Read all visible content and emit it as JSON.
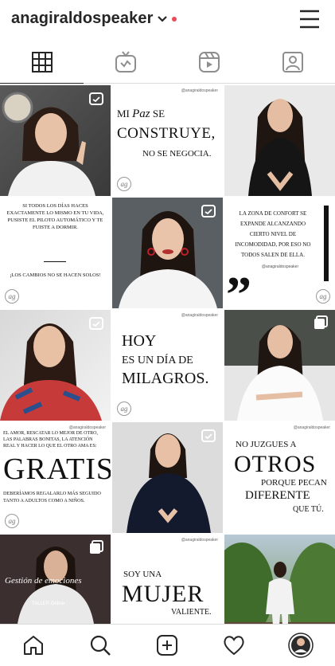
{
  "profile": {
    "username": "anagiraldospeaker"
  },
  "header": {
    "chevron_icon": "chevron-down-icon",
    "notification_color": "#ed4956",
    "menu_icon": "hamburger-menu-icon"
  },
  "tabs": [
    {
      "icon": "grid-icon",
      "active": true
    },
    {
      "icon": "igtv-icon",
      "active": false
    },
    {
      "icon": "reels-icon",
      "active": false
    },
    {
      "icon": "tagged-icon",
      "active": false
    }
  ],
  "posts": {
    "handle": "@anagiraldospeaker",
    "watermark": "ag",
    "p2": {
      "l1_a": "MI",
      "l1_script": "Paz",
      "l1_b": "SE",
      "l2": "CONSTRUYE,",
      "l3": "NO SE NEGOCIA."
    },
    "p4": {
      "l1": "SI TODOS LOS DÍAS HACES",
      "l2": "EXACTAMENTE LO MISMO EN TU VIDA,",
      "l3": "PUSISTE EL PILOTO AUTOMÁTICO Y TE",
      "l4": "FUISTE A DORMIR.",
      "l5": "¡LOS CAMBIOS NO SE HACEN SOLOS!"
    },
    "p6": {
      "l1": "LA ZONA DE CONFORT SE",
      "l2": "EXPANDE ALCANZANDO",
      "l3": "CIERTO NIVEL DE",
      "l4": "INCOMODIDAD, POR ESO NO",
      "l5": "TODOS SALEN DE ELLA.",
      "l6": "@anagiraldospeaker"
    },
    "p8": {
      "l1": "HOY",
      "l2": "ES UN DÍA DE",
      "l3": "MILAGROS."
    },
    "p10": {
      "l1": "EL AMOR, RESCATAR LO MEJOR DE OTRO,",
      "l2": "LAS PALABRAS BONITAS, LA ATENCIÓN",
      "l3": "REAL Y HACER LO QUE EL OTRO AMA ES:",
      "l4": "GRATIS",
      "l5": "DEBERÍAMOS REGALARLO MÁS SEGUIDO",
      "l6": "TANTO A ADULTOS COMO A NIÑOS."
    },
    "p12": {
      "l1": "NO JUZGUES A",
      "l2": "OTROS",
      "l3": "PORQUE PECAN",
      "l4": "DIFERENTE",
      "l5": "QUE TÚ."
    },
    "p13": {
      "l1": "Gestión de emociones",
      "l2": "TALLER Online"
    },
    "p14": {
      "l1": "SOY UNA",
      "l2": "MUJER",
      "l3": "VALIENTE."
    }
  },
  "bottom_nav": [
    {
      "icon": "home-icon"
    },
    {
      "icon": "search-icon"
    },
    {
      "icon": "new-post-icon"
    },
    {
      "icon": "activity-heart-icon"
    },
    {
      "icon": "profile-avatar-icon"
    }
  ]
}
